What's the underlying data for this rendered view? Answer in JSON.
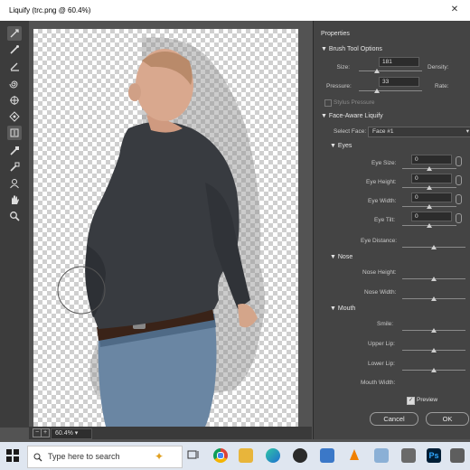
{
  "window": {
    "title": "Liquify (trc.png @ 60.4%)",
    "controls": {
      "close": "✕"
    }
  },
  "tools": [
    "forward-warp",
    "reconstruct",
    "smooth",
    "twirl",
    "pucker",
    "bloat",
    "push-left",
    "freeze-mask",
    "thaw-mask",
    "face",
    "hand",
    "zoom"
  ],
  "status": {
    "zoom": "60.4%",
    "zoom_out": "−",
    "zoom_in": "+"
  },
  "panel": {
    "title": "Properties",
    "brush_section": "Brush Tool Options",
    "size_label": "Size:",
    "size_value": "181",
    "density_label": "Density:",
    "pressure_label": "Pressure:",
    "pressure_value": "33",
    "rate_label": "Rate:",
    "stylus_label": "Stylus Pressure",
    "face_section": "Face-Aware Liquify",
    "select_face_label": "Select Face:",
    "select_face_value": "Face #1",
    "eyes_header": "Eyes",
    "eye_size_label": "Eye Size:",
    "eye_size_value": "0",
    "eye_height_label": "Eye Height:",
    "eye_height_value": "0",
    "eye_width_label": "Eye Width:",
    "eye_width_value": "0",
    "eye_tilt_label": "Eye Tilt:",
    "eye_tilt_value": "0",
    "eye_distance_label": "Eye Distance:",
    "nose_header": "Nose",
    "nose_height_label": "Nose Height:",
    "nose_width_label": "Nose Width:",
    "mouth_header": "Mouth",
    "smile_label": "Smile:",
    "upper_lip_label": "Upper Lip:",
    "lower_lip_label": "Lower Lip:",
    "mouth_width_label": "Mouth Width:",
    "preview_label": "Preview",
    "cancel_label": "Cancel",
    "ok_label": "OK"
  },
  "taskbar": {
    "search_placeholder": "Type here to search",
    "apps": [
      "task-view",
      "chrome",
      "file-explorer",
      "edge",
      "obs",
      "mail",
      "vlc",
      "paint",
      "unknown",
      "photoshop",
      "media",
      "camera"
    ],
    "photoshop_label": "Ps"
  },
  "colors": {
    "panel_bg": "#444444",
    "canvas_surround": "#535353",
    "shirt": "#3a3d42",
    "jeans": "#6a86a3"
  }
}
